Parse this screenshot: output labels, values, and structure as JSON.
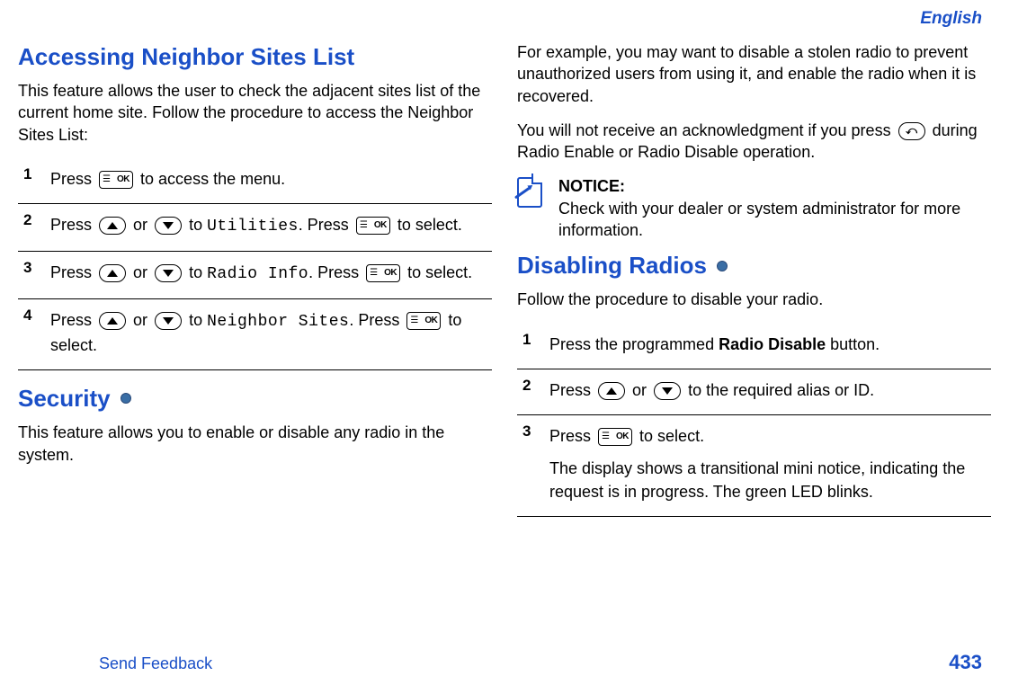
{
  "header": {
    "language": "English"
  },
  "left": {
    "h1": "Accessing Neighbor Sites List",
    "intro": "This feature allows the user to check the adjacent sites list of the current home site. Follow the procedure to access the Neighbor Sites List:",
    "steps": {
      "s1": {
        "t1": "Press ",
        "t2": " to access the menu."
      },
      "s2": {
        "t1": "Press ",
        "t2": " or ",
        "t3": " to ",
        "menu": "Utilities",
        "t4": ". Press ",
        "t5": " to select."
      },
      "s3": {
        "t1": "Press ",
        "t2": " or ",
        "t3": " to ",
        "menu": "Radio Info",
        "t4": ". Press ",
        "t5": " to select."
      },
      "s4": {
        "t1": "Press ",
        "t2": " or ",
        "t3": " to ",
        "menu": "Neighbor Sites",
        "t4": ". Press ",
        "t5": " to select."
      }
    },
    "h2": "Security",
    "sec_intro": "This feature allows you to enable or disable any radio in the system."
  },
  "right": {
    "p1": "For example, you may want to disable a stolen radio to prevent unauthorized users from using it, and enable the radio when it is recovered.",
    "p2a": "You will not receive an acknowledgment if you press ",
    "p2b": " during Radio Enable or Radio Disable operation.",
    "notice_label": "NOTICE:",
    "notice_body": "Check with your dealer or system administrator for more information.",
    "h3": "Disabling Radios",
    "dis_intro": "Follow the procedure to disable your radio.",
    "dsteps": {
      "s1": {
        "t1": "Press the programmed ",
        "bold": "Radio Disable",
        "t2": " button."
      },
      "s2": {
        "t1": "Press ",
        "t2": " or ",
        "t3": " to the required alias or ID."
      },
      "s3": {
        "t1": "Press ",
        "t2": " to select.",
        "extra": "The display shows a transitional mini notice, indicating the request is in progress. The green LED blinks."
      }
    }
  },
  "footer": {
    "feedback": "Send Feedback",
    "page": "433"
  }
}
